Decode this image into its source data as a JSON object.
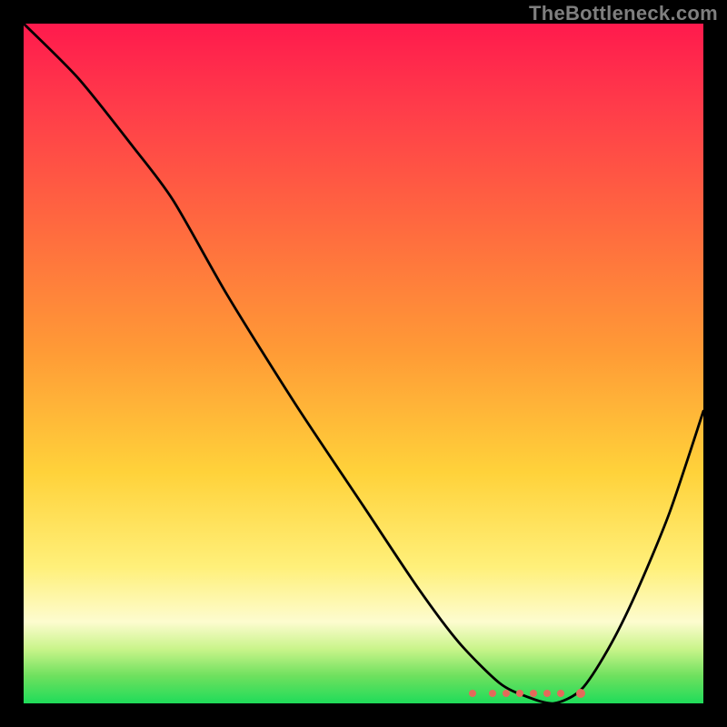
{
  "watermark": "TheBottleneck.com",
  "colors": {
    "background": "#000000",
    "curve": "#000000",
    "watermark": "#7f7f7f",
    "dot": "#e46a5a",
    "gradient_stops": [
      "#ff1a4d",
      "#ff3b4a",
      "#ff6a3f",
      "#ff9a36",
      "#ffd23a",
      "#fff07a",
      "#fdfccf",
      "#c9f48a",
      "#6ee05e",
      "#1fdc5a"
    ]
  },
  "chart_data": {
    "type": "line",
    "title": "",
    "xlabel": "",
    "ylabel": "",
    "xlim": [
      0,
      100
    ],
    "ylim": [
      0,
      100
    ],
    "grid": false,
    "legend": null,
    "series": [
      {
        "name": "curve",
        "x": [
          0,
          8,
          16,
          22,
          30,
          40,
          50,
          58,
          64,
          70,
          74,
          78,
          82,
          86,
          90,
          95,
          100
        ],
        "values": [
          100,
          92,
          82,
          74,
          60,
          44,
          29,
          17,
          9,
          3,
          1,
          0,
          2,
          8,
          16,
          28,
          43
        ]
      }
    ],
    "valley_markers_x": [
      66,
      69,
      71,
      73,
      75,
      77,
      79,
      82
    ],
    "annotations": []
  }
}
